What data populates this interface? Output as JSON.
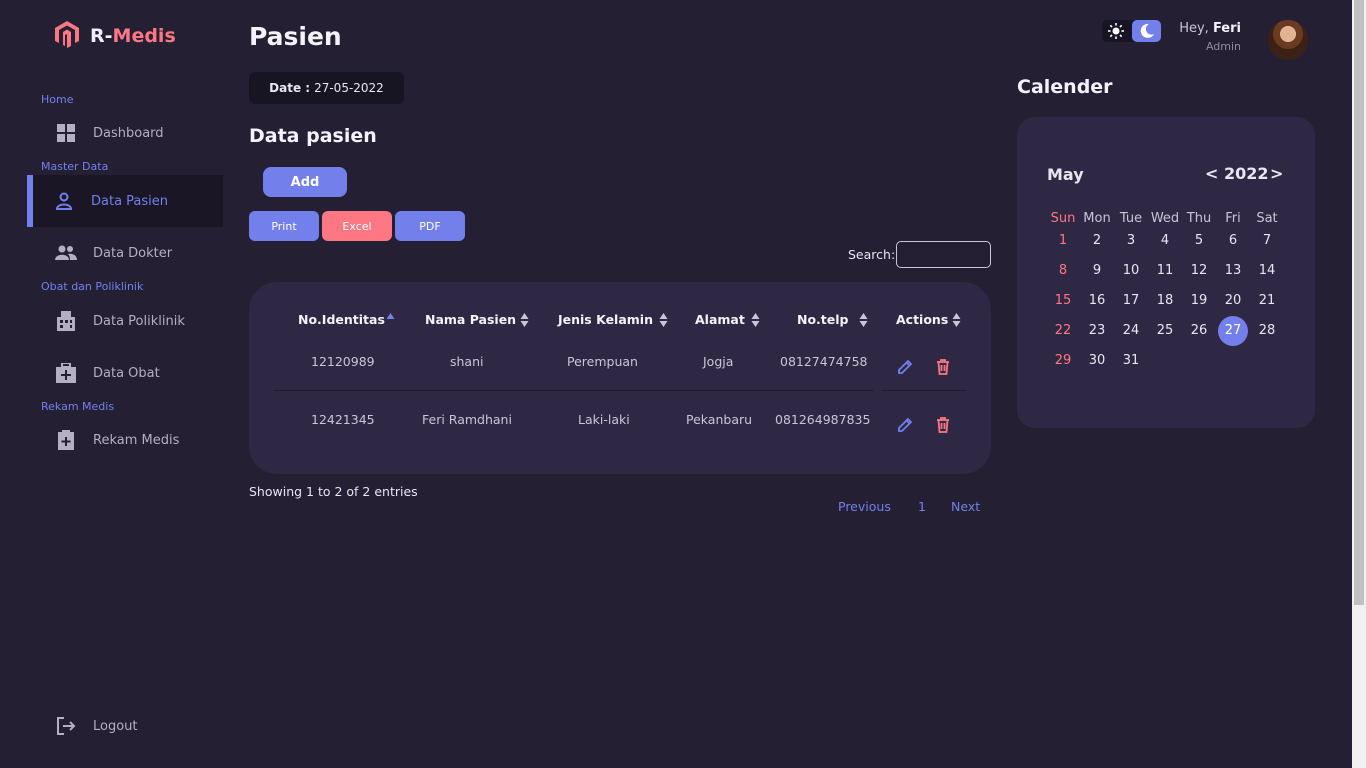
{
  "app": {
    "brand_prefix": "R-",
    "brand_name": "Medis"
  },
  "sidebar": {
    "sections": {
      "home": "Home",
      "master": "Master Data",
      "obat": "Obat dan Poliklinik",
      "rekam": "Rekam Medis"
    },
    "items": [
      {
        "label": "Dashboard",
        "icon": "grid-icon"
      },
      {
        "label": "Data Pasien",
        "icon": "person-icon",
        "active": true
      },
      {
        "label": "Data Dokter",
        "icon": "people-icon"
      },
      {
        "label": "Data Poliklinik",
        "icon": "building-icon"
      },
      {
        "label": "Data Obat",
        "icon": "medkit-icon"
      },
      {
        "label": "Rekam Medis",
        "icon": "medical-record-icon"
      }
    ],
    "logout": "Logout"
  },
  "header": {
    "title": "Pasien",
    "greeting": "Hey,",
    "user": "Feri",
    "role": "Admin"
  },
  "date": {
    "label": "Date :",
    "value": "27-05-2022"
  },
  "section_title": "Data pasien",
  "buttons": {
    "add": "Add",
    "print": "Print",
    "excel": "Excel",
    "pdf": "PDF"
  },
  "search": {
    "label": "Search:",
    "value": ""
  },
  "table": {
    "columns": [
      "No.Identitas",
      "Nama Pasien",
      "Jenis Kelamin",
      "Alamat",
      "No.telp",
      "Actions"
    ],
    "rows": [
      [
        "12120989",
        "shani",
        "Perempuan",
        "Jogja",
        "08127474758"
      ],
      [
        "12421345",
        "Feri Ramdhani",
        "Laki-laki",
        "Pekanbaru",
        "081264987835"
      ]
    ]
  },
  "footer": {
    "showing": "Showing 1 to 2 of 2 entries",
    "previous": "Previous",
    "page": "1",
    "next": "Next"
  },
  "calendar": {
    "title": "Calender",
    "month": "May",
    "year": "2022",
    "prev": "<",
    "next": ">",
    "weekdays": [
      "Sun",
      "Mon",
      "Tue",
      "Wed",
      "Thu",
      "Fri",
      "Sat"
    ],
    "weeks": [
      [
        "1",
        "2",
        "3",
        "4",
        "5",
        "6",
        "7"
      ],
      [
        "8",
        "9",
        "10",
        "11",
        "12",
        "13",
        "14"
      ],
      [
        "15",
        "16",
        "17",
        "18",
        "19",
        "20",
        "21"
      ],
      [
        "22",
        "23",
        "24",
        "25",
        "26",
        "27",
        "28"
      ],
      [
        "29",
        "30",
        "31",
        "",
        "",
        "",
        ""
      ]
    ],
    "today": "27"
  },
  "colors": {
    "accent": "#7380ec",
    "danger": "#ff7782",
    "background": "#241f33",
    "card": "#2e2845"
  }
}
